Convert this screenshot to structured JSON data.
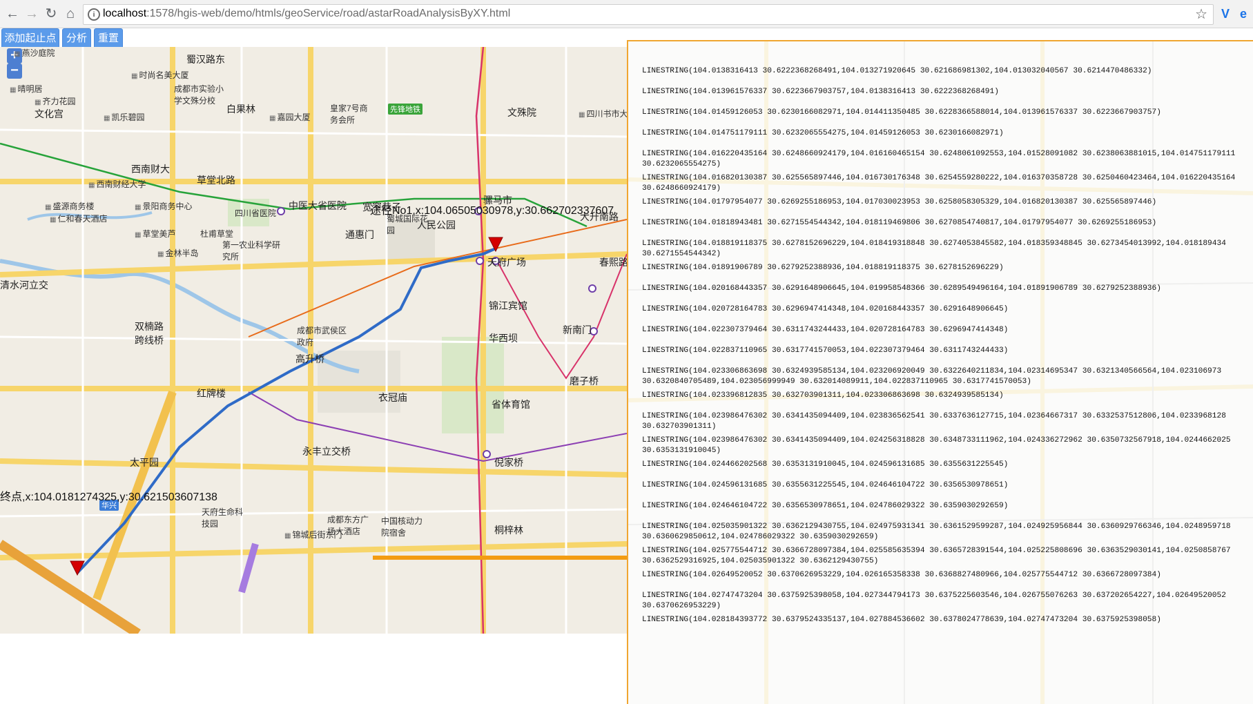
{
  "browser": {
    "url_host": "localhost",
    "url_path": ":1578/hgis-web/demo/htmls/geoService/road/astarRoadAnalysisByXY.html",
    "back_icon": "arrow-left-icon",
    "forward_icon": "arrow-right-icon",
    "reload_icon": "reload-icon",
    "home_icon": "home-icon",
    "bookmark_icon": "star-icon"
  },
  "toolbar": {
    "add_points": "添加起止点",
    "analyze": "分析",
    "reset": "重置"
  },
  "map": {
    "zoom_in": "+",
    "zoom_out": "−",
    "route_start_label": "途径No1,x:104.06505030978,y:30.662702337607",
    "route_end_label": "终点,x:104.0181274325,y:30.621503607138",
    "labels": [
      "燕沙庭院",
      "蜀汉路东",
      "时尚名美大厦",
      "晴明居",
      "齐力花园",
      "成都市实验小学文殊分校",
      "文化宫",
      "白果林",
      "凯乐碧园",
      "嘉园大厦",
      "皇家7号商务会所",
      "先锋地铁",
      "文殊院",
      "四川书市大楼",
      "西南财大",
      "草堂北路",
      "西南财经大学",
      "中医大省医院",
      "宽窄巷子",
      "骡马市",
      "大升南路",
      "盛源商务楼",
      "景阳商务中心",
      "四川省医院",
      "仁和春天酒店",
      "通惠门",
      "蜀城国际花园",
      "天府广场",
      "草堂美芦",
      "杜甫草堂",
      "人民公园",
      "清水河立交",
      "金林半岛",
      "第一农业科学研究所",
      "春熙路",
      "锦江宾馆",
      "双楠路跨线桥",
      "成都市武侯区政府",
      "高升桥",
      "华西坝",
      "新南门",
      "红牌楼",
      "衣冠庙",
      "省体育馆",
      "磨子桥",
      "太平园",
      "永丰立交桥",
      "倪家桥",
      "桐梓林",
      "华兴",
      "天府生命科技园",
      "成都东方广场大酒店",
      "中国核动力院宿舍",
      "锦城后街东门"
    ]
  },
  "panel": {
    "lines": [
      "LINESTRING(104.0138316413 30.6222368268491,104.013271920645 30.621686981302,104.013032040567 30.6214470486332)",
      "LINESTRING(104.013961576337 30.6223667903757,104.0138316413 30.6222368268491)",
      "LINESTRING(104.01459126053 30.6230166082971,104.014411350485 30.6228366588014,104.013961576337 30.6223667903757)",
      "LINESTRING(104.014751179111 30.6232065554275,104.01459126053 30.6230166082971)",
      "LINESTRING(104.016220435164 30.6248660924179,104.016160465154 30.6248061092553,104.01528091082 30.6238063881015,104.014751179111\n30.6232065554275)",
      "LINESTRING(104.016820130387 30.625565897446,104.016730176348 30.6254559280222,104.016370358728 30.6250460423464,104.016220435164\n30.6248660924179)",
      "LINESTRING(104.01797954077 30.6269255186953,104.017030023953 30.6258058305329,104.016820130387 30.625565897446)",
      "LINESTRING(104.01818943481 30.6271554544342,104.018119469806 30.6270854740817,104.01797954077 30.6269255186953)",
      "LINESTRING(104.018819118375 30.6278152696229,104.018419318848 30.6274053845582,104.018359348845 30.6273454013992,104.018189434\n30.6271554544342)",
      "LINESTRING(104.01891906789 30.6279252388936,104.018819118375 30.6278152696229)",
      "LINESTRING(104.020168443357 30.6291648906645,104.019958548366 30.6289549496164,104.01891906789 30.6279252388936)",
      "LINESTRING(104.020728164783 30.6296947414348,104.020168443357 30.6291648906645)",
      "LINESTRING(104.022307379464 30.6311743244433,104.020728164783 30.6296947414348)",
      "LINESTRING(104.022837110965 30.6317741570053,104.022307379464 30.6311743244433)",
      "LINESTRING(104.023306863698 30.6324939585134,104.023206920049 30.6322640211834,104.02314695347 30.6321340566564,104.023106973\n30.6320840705489,104.023056999949 30.632014089911,104.022837110965 30.6317741570053)",
      "LINESTRING(104.023396812835 30.632703901311,104.023306863698 30.6324939585134)",
      "LINESTRING(104.023986476302 30.6341435094409,104.023836562541 30.6337636127715,104.02364667317 30.6332537512806,104.0233968128\n30.632703901311)",
      "LINESTRING(104.023986476302 30.6341435094409,104.024256318828 30.6348733111962,104.024336272962 30.6350732567918,104.0244662025\n30.6353131910045)",
      "LINESTRING(104.024466202568 30.6353131910045,104.024596131685 30.6355631225545)",
      "LINESTRING(104.024596131685 30.6355631225545,104.024646104722 30.6356530978651)",
      "LINESTRING(104.024646104722 30.6356530978651,104.024786029322 30.6359030292659)",
      "LINESTRING(104.025035901322 30.6362129430755,104.024975931341 30.6361529599287,104.024925956844 30.6360929766346,104.0248959718\n30.6360629850612,104.024786029322 30.6359030292659)",
      "LINESTRING(104.025775544712 30.6366728097384,104.025585635394 30.6365728391544,104.025225808696 30.6363529030141,104.0250858767\n30.6362529316925,104.025035901322 30.6362129430755)",
      "LINESTRING(104.02649520052 30.6370626953229,104.026165358338 30.6368827480966,104.025775544712 30.6366728097384)",
      "LINESTRING(104.02747473204 30.6375925398058,104.027344794173 30.6375225603546,104.026755076263 30.637202654227,104.02649520052\n30.6370626953229)",
      "LINESTRING(104.028184393772 30.6379524335137,104.027884536602 30.6378024778639,104.02747473204 30.6375925398058)"
    ]
  }
}
